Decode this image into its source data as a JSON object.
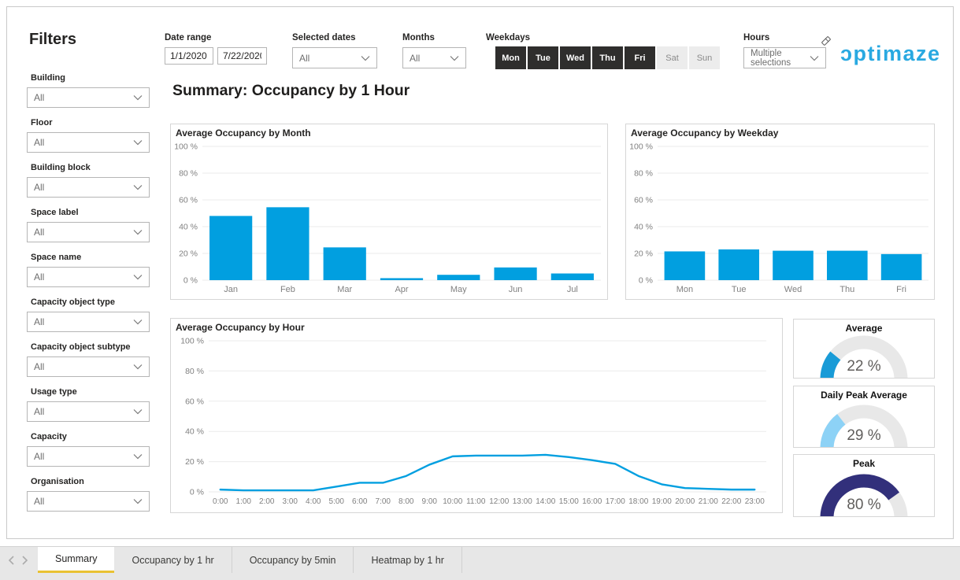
{
  "page": {
    "title_heading": "Summary: Occupancy by 1 Hour"
  },
  "filters_panel": {
    "title": "Filters",
    "items": [
      {
        "label": "Building",
        "value": "All"
      },
      {
        "label": "Floor",
        "value": "All"
      },
      {
        "label": "Building block",
        "value": "All"
      },
      {
        "label": "Space label",
        "value": "All"
      },
      {
        "label": "Space name",
        "value": "All"
      },
      {
        "label": "Capacity object type",
        "value": "All"
      },
      {
        "label": "Capacity object subtype",
        "value": "All"
      },
      {
        "label": "Usage type",
        "value": "All"
      },
      {
        "label": "Capacity",
        "value": "All"
      },
      {
        "label": "Organisation",
        "value": "All"
      }
    ]
  },
  "toolbar": {
    "date_range": {
      "label": "Date range",
      "start": "1/1/2020",
      "end": "7/22/2020"
    },
    "selected_dates": {
      "label": "Selected dates",
      "value": "All"
    },
    "months": {
      "label": "Months",
      "value": "All"
    },
    "weekdays": {
      "label": "Weekdays",
      "days": [
        {
          "label": "Mon",
          "selected": true
        },
        {
          "label": "Tue",
          "selected": true
        },
        {
          "label": "Wed",
          "selected": true
        },
        {
          "label": "Thu",
          "selected": true
        },
        {
          "label": "Fri",
          "selected": true
        },
        {
          "label": "Sat",
          "selected": false
        },
        {
          "label": "Sun",
          "selected": false
        }
      ]
    },
    "hours": {
      "label": "Hours",
      "value": "Multiple selections"
    },
    "logo_text": "ɔptimaze"
  },
  "chart_data": [
    {
      "type": "bar",
      "title": "Average Occupancy by Month",
      "categories": [
        "Jan",
        "Feb",
        "Mar",
        "Apr",
        "May",
        "Jun",
        "Jul"
      ],
      "values": [
        48,
        54.5,
        24.5,
        1.5,
        4,
        9.5,
        5
      ],
      "xlabel": "",
      "ylabel": "",
      "ylim": [
        0,
        100
      ],
      "ytick_values": [
        0,
        20,
        40,
        60,
        80,
        100
      ],
      "ytick_labels": [
        "0 %",
        "20 %",
        "40 %",
        "60 %",
        "80 %",
        "100 %"
      ],
      "grid": true,
      "legend": "none",
      "bar_color": "#019FE0"
    },
    {
      "type": "bar",
      "title": "Average Occupancy by Weekday",
      "categories": [
        "Mon",
        "Tue",
        "Wed",
        "Thu",
        "Fri"
      ],
      "values": [
        21.5,
        23,
        22,
        22,
        19.5
      ],
      "xlabel": "",
      "ylabel": "",
      "ylim": [
        0,
        100
      ],
      "ytick_values": [
        0,
        20,
        40,
        60,
        80,
        100
      ],
      "ytick_labels": [
        "0 %",
        "20 %",
        "40 %",
        "60 %",
        "80 %",
        "100 %"
      ],
      "grid": true,
      "legend": "none",
      "bar_color": "#019FE0"
    },
    {
      "type": "line",
      "title": "Average Occupancy by Hour",
      "categories": [
        "0:00",
        "1:00",
        "2:00",
        "3:00",
        "4:00",
        "5:00",
        "6:00",
        "7:00",
        "8:00",
        "9:00",
        "10:00",
        "11:00",
        "12:00",
        "13:00",
        "14:00",
        "15:00",
        "16:00",
        "17:00",
        "18:00",
        "19:00",
        "20:00",
        "21:00",
        "22:00",
        "23:00"
      ],
      "values": [
        1.5,
        1,
        1,
        1,
        1,
        3.5,
        6,
        6,
        10.5,
        18,
        23.5,
        24,
        24,
        24,
        24.5,
        23,
        21,
        18.5,
        10.5,
        5,
        2.5,
        2,
        1.5,
        1.5
      ],
      "xlabel": "",
      "ylabel": "",
      "ylim": [
        0,
        100
      ],
      "ytick_values": [
        0,
        20,
        40,
        60,
        80,
        100
      ],
      "ytick_labels": [
        "0 %",
        "20 %",
        "40 %",
        "60 %",
        "80 %",
        "100 %"
      ],
      "grid": true,
      "legend": "none",
      "line_color": "#019FE0"
    }
  ],
  "gauges": [
    {
      "title": "Average",
      "value_label": "22 %",
      "percent": 22,
      "color": "#199BD7"
    },
    {
      "title": "Daily Peak Average",
      "value_label": "29 %",
      "percent": 29,
      "color": "#8DD2F6"
    },
    {
      "title": "Peak",
      "value_label": "80 %",
      "percent": 80,
      "color": "#32307B"
    }
  ],
  "gauge_track_color": "#e8e8e8",
  "tab_bar": {
    "tabs": [
      {
        "label": "Summary",
        "active": true
      },
      {
        "label": "Occupancy by 1 hr",
        "active": false
      },
      {
        "label": "Occupancy by 5min",
        "active": false
      },
      {
        "label": "Heatmap by 1 hr",
        "active": false
      }
    ]
  },
  "colors": {
    "accent_blue": "#019FE0",
    "brand_cyan": "#29a9e1",
    "tab_underline": "#e9c233"
  }
}
